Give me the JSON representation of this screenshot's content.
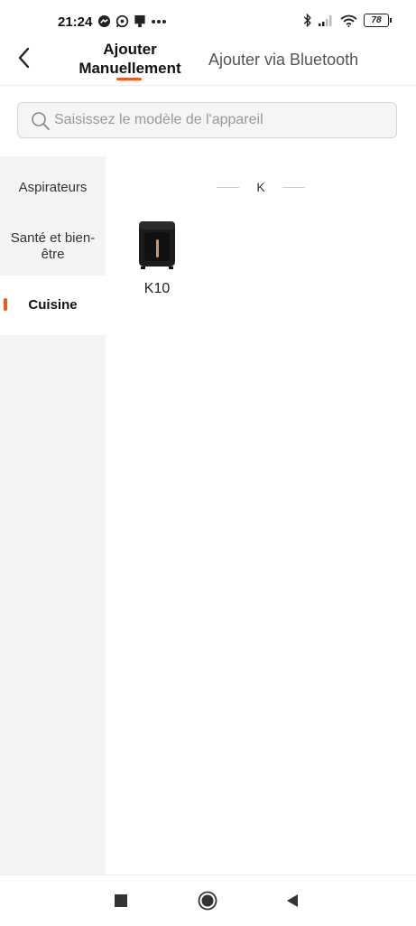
{
  "status_bar": {
    "time": "21:24",
    "battery": "78",
    "left_icons": [
      "messenger-icon",
      "whatsapp-icon",
      "notification-icon",
      "more-dots-icon"
    ],
    "right_icons": [
      "bluetooth-icon",
      "signal-icon",
      "wifi-icon",
      "battery-icon"
    ]
  },
  "header": {
    "tab_manual": "Ajouter Manuellement",
    "tab_bluetooth": "Ajouter via Bluetooth",
    "accent_color": "#f05a1c"
  },
  "search": {
    "placeholder": "Saisissez le modèle de l'appareil",
    "value": ""
  },
  "sidebar": {
    "items": [
      {
        "label": "Aspirateurs",
        "active": false
      },
      {
        "label": "Santé et bien-être",
        "active": false
      },
      {
        "label": "Cuisine",
        "active": true
      }
    ]
  },
  "content": {
    "section_letter": "K",
    "devices": [
      {
        "label": "K10",
        "image": "air-fryer-image"
      }
    ]
  },
  "nav_bar": {
    "buttons": [
      "recent-apps-icon",
      "home-icon",
      "back-icon"
    ]
  }
}
